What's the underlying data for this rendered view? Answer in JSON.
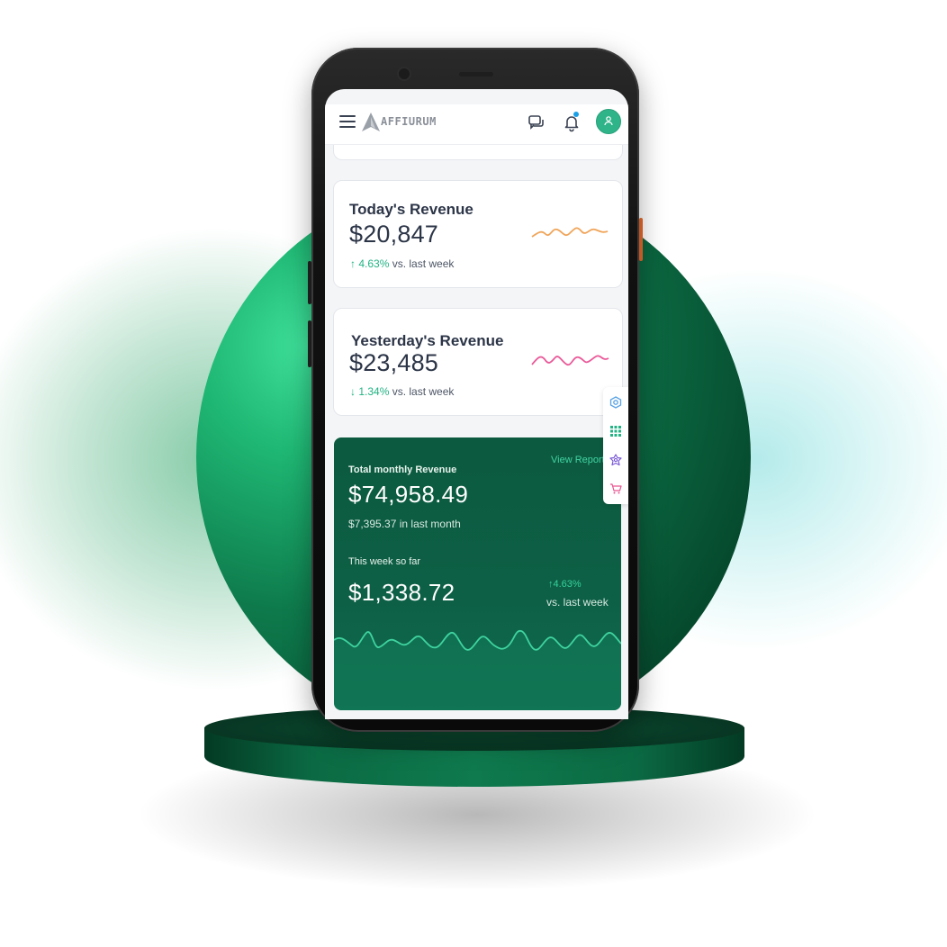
{
  "header": {
    "brand": "AFFIURUM",
    "icons": [
      "menu-icon",
      "chat-icon",
      "bell-icon",
      "user-icon"
    ]
  },
  "today": {
    "title": "Today's Revenue",
    "value": "$20,847",
    "arrow": "↑",
    "percent": "4.63%",
    "compare": " vs. last week",
    "spark_color": "#f0a55a"
  },
  "yesterday": {
    "title": "Yesterday's Revenue",
    "value": "$23,485",
    "arrow": "↓",
    "percent": "1.34%",
    "compare": " vs. last week",
    "spark_color": "#ea5a99"
  },
  "monthly": {
    "title": "Total monthly Revenue",
    "link": "View Report",
    "total": "$74,958.49",
    "last_month_value": "$7,395.37",
    "last_month_label": " in last month",
    "week_label": "This week so far",
    "week_value": "$1,338.72",
    "week_arrow": "↑",
    "week_percent": "4.63%",
    "week_compare": "vs. last week"
  },
  "floating_toolbar": [
    "settings-icon",
    "apps-grid-icon",
    "theme-icon",
    "cart-icon"
  ],
  "colors": {
    "brand_green": "#0d6046",
    "accent_teal": "#21b384",
    "avatar": "#2fb48a"
  }
}
